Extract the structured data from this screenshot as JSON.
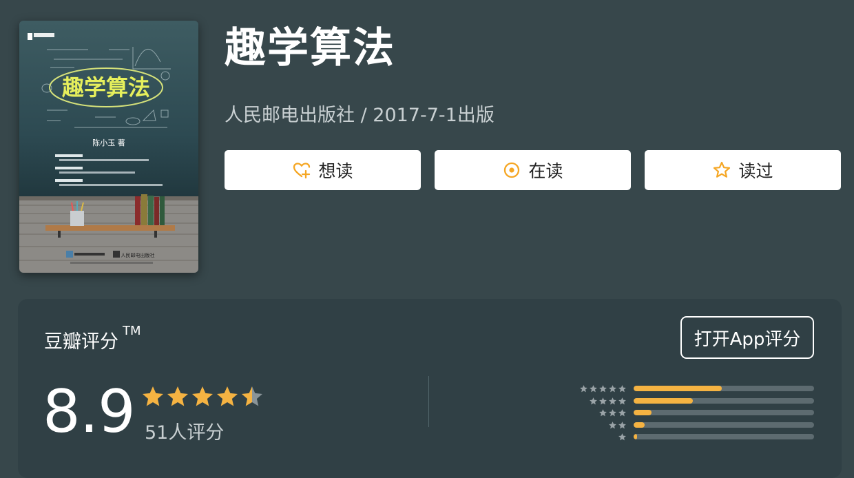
{
  "book": {
    "title": "趣学算法",
    "meta": "人民邮电出版社 / 2017-7-1出版"
  },
  "cover": {
    "title": "趣学算法",
    "author": "陈小玉 著",
    "publisher_logo": "人民邮电出版社"
  },
  "actions": [
    {
      "label": "想读",
      "icon": "heart-plus-icon"
    },
    {
      "label": "在读",
      "icon": "target-circle-icon"
    },
    {
      "label": "读过",
      "icon": "star-outline-icon"
    }
  ],
  "rating": {
    "section_title": "豆瓣评分",
    "trademark": "TM",
    "open_app_label": "打开App评分",
    "score": "8.9",
    "score_value": 8.9,
    "count_text": "51人评分",
    "stars_value": 4.5,
    "distribution": [
      {
        "stars": 5,
        "fraction": 0.49
      },
      {
        "stars": 4,
        "fraction": 0.33
      },
      {
        "stars": 3,
        "fraction": 0.1
      },
      {
        "stars": 2,
        "fraction": 0.06
      },
      {
        "stars": 1,
        "fraction": 0.02
      }
    ]
  },
  "colors": {
    "background": "#37474b",
    "panel": "#304045",
    "accent_star": "#f5b342",
    "bar_track": "#5d6b70"
  }
}
